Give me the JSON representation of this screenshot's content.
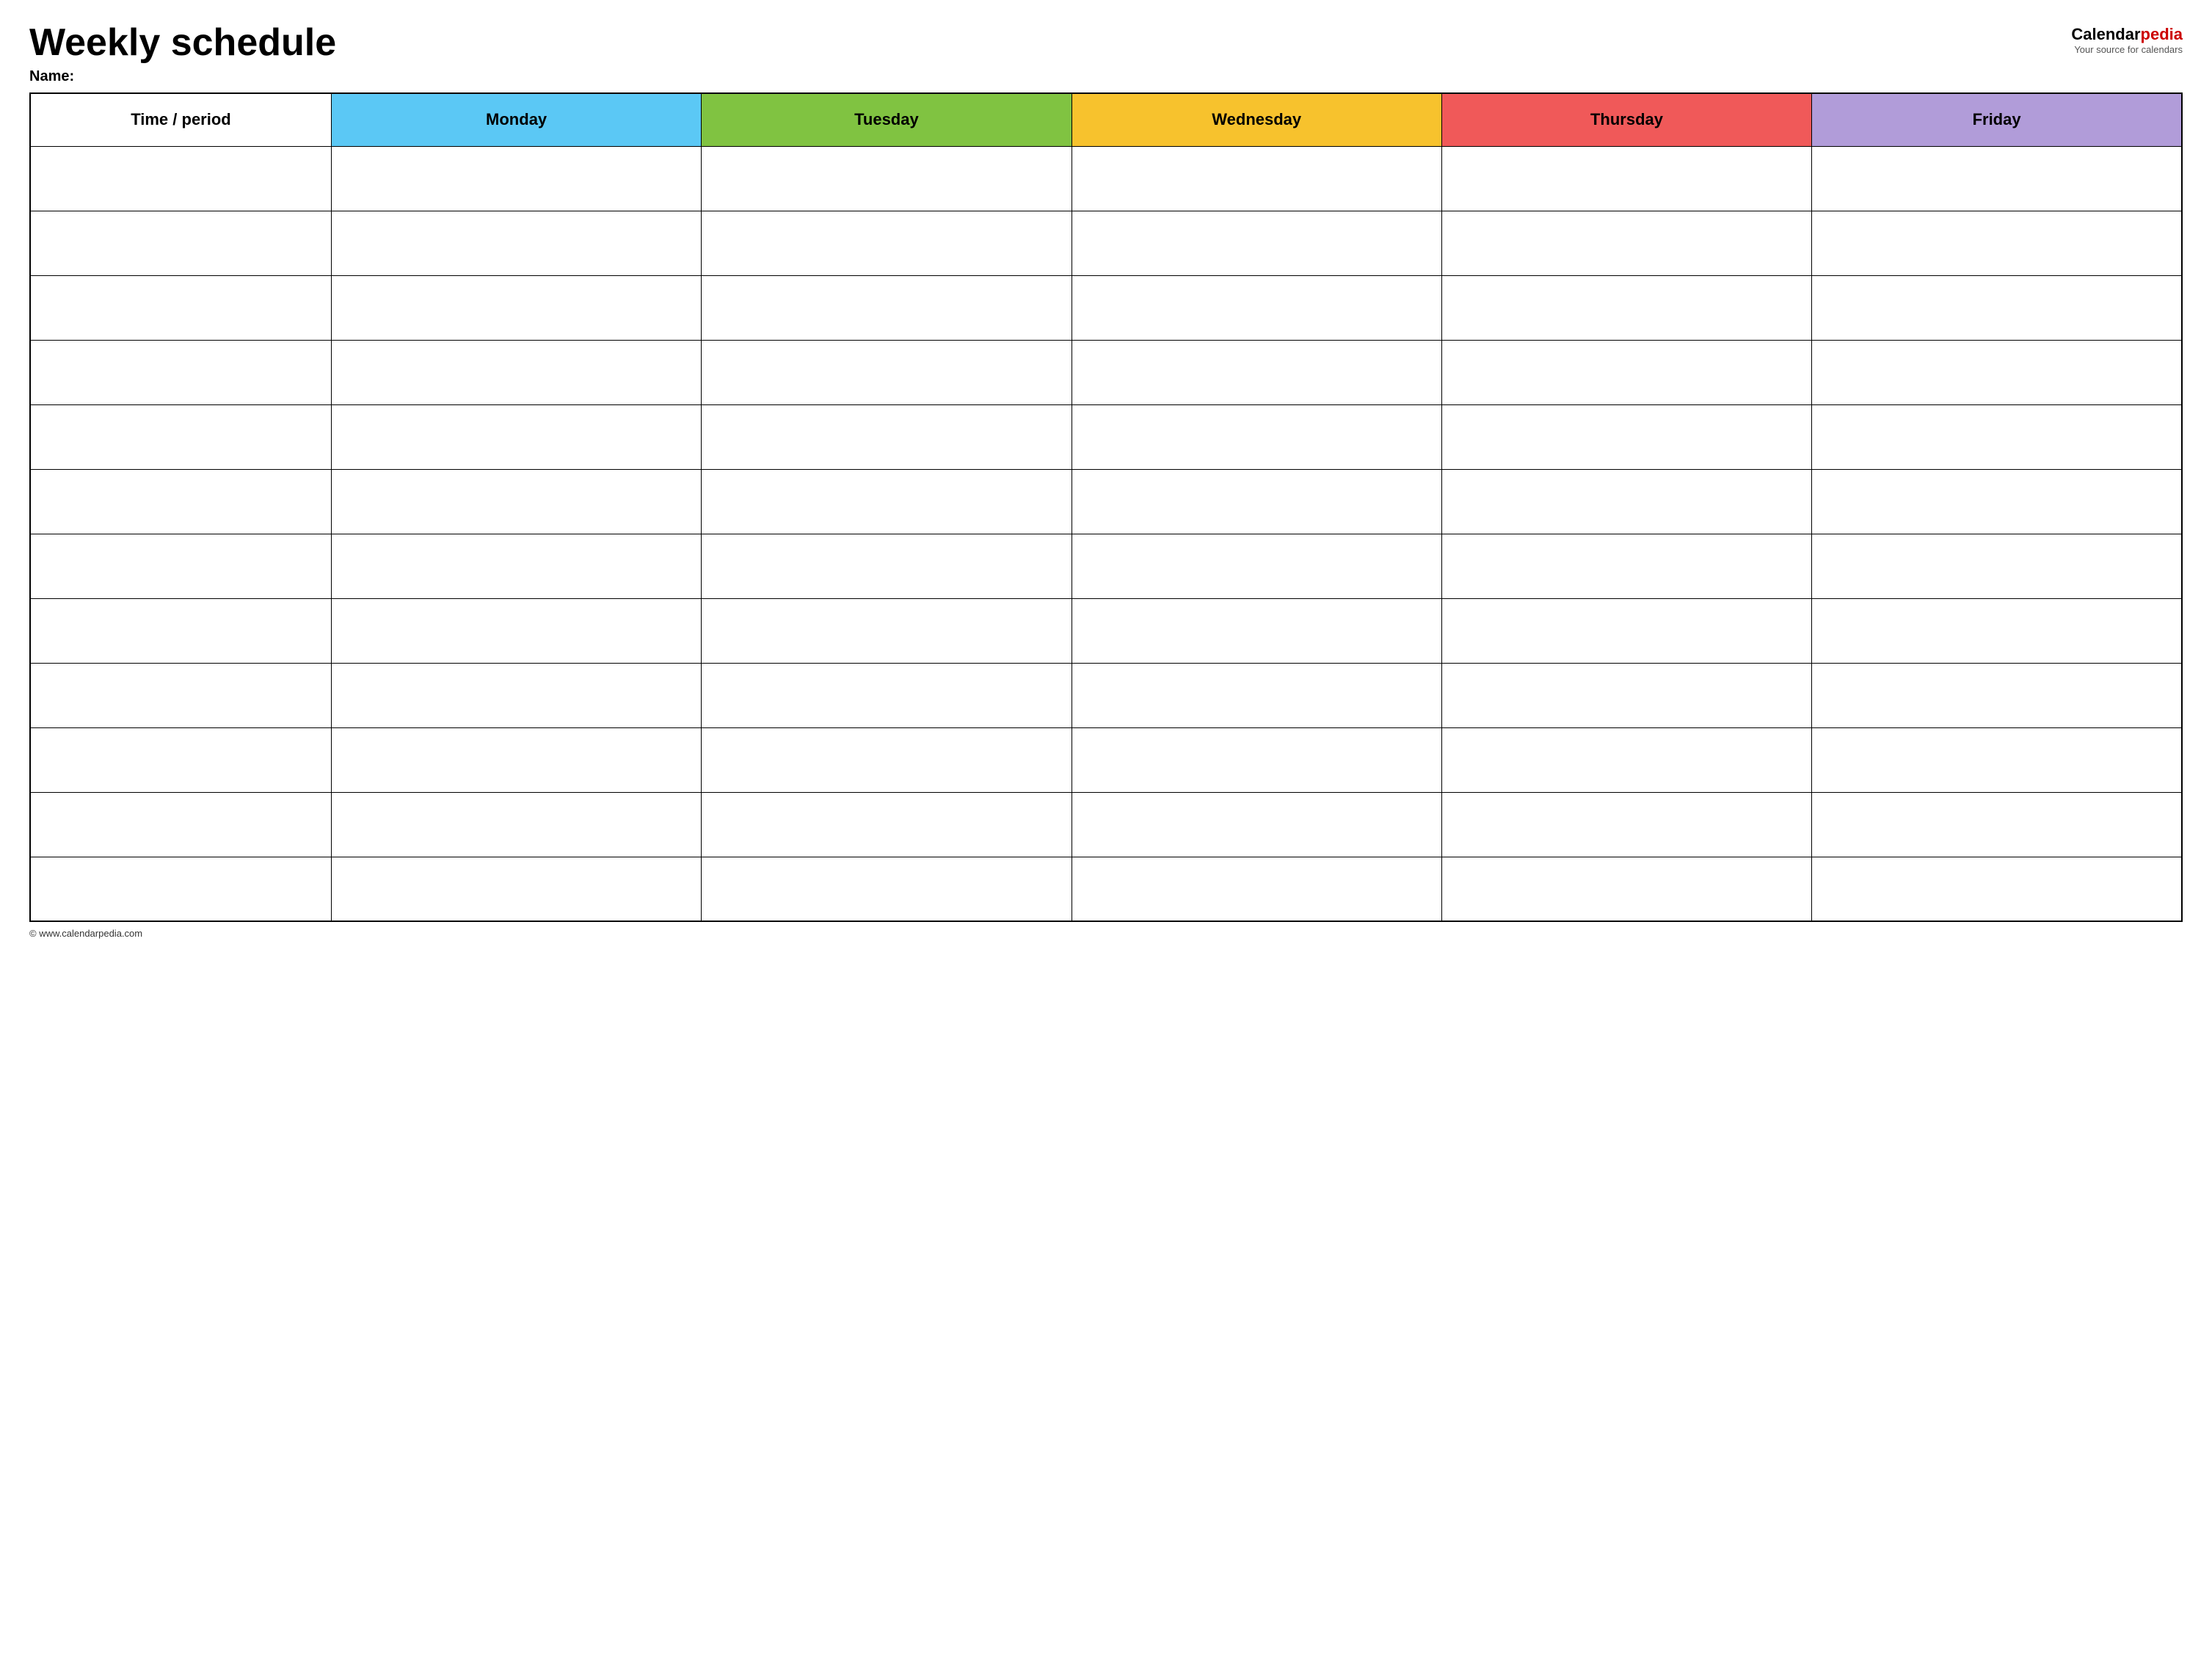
{
  "header": {
    "title": "Weekly schedule",
    "name_label": "Name:",
    "logo_calendar": "Calendar",
    "logo_pedia": "pedia",
    "logo_tagline": "Your source for calendars"
  },
  "table": {
    "columns": [
      {
        "id": "time-period",
        "label": "Time / period",
        "color_class": "th-time-period"
      },
      {
        "id": "monday",
        "label": "Monday",
        "color_class": "th-monday"
      },
      {
        "id": "tuesday",
        "label": "Tuesday",
        "color_class": "th-tuesday"
      },
      {
        "id": "wednesday",
        "label": "Wednesday",
        "color_class": "th-wednesday"
      },
      {
        "id": "thursday",
        "label": "Thursday",
        "color_class": "th-thursday"
      },
      {
        "id": "friday",
        "label": "Friday",
        "color_class": "th-friday"
      }
    ],
    "row_count": 12
  },
  "footer": {
    "copyright": "© www.calendarpedia.com"
  }
}
